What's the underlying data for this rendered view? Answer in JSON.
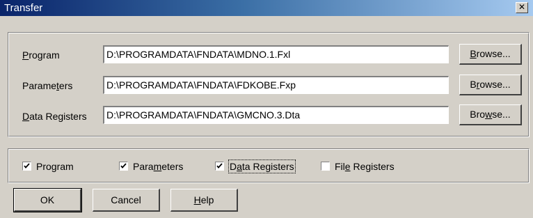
{
  "window": {
    "title": "Transfer",
    "close_icon": "close-icon"
  },
  "files": {
    "program": {
      "label_pre": "",
      "label_u": "P",
      "label_post": "rogram",
      "path": "D:\\PROGRAMDATA\\FNDATA\\MDNO.1.Fxl"
    },
    "parameters": {
      "label_pre": "Parame",
      "label_u": "t",
      "label_post": "ers",
      "path": "D:\\PROGRAMDATA\\FNDATA\\FDKOBE.Fxp"
    },
    "data_registers": {
      "label_pre": "",
      "label_u": "D",
      "label_post": "ata Registers",
      "path": "D:\\PROGRAMDATA\\FNDATA\\GMCNO.3.Dta"
    },
    "browse_buttons": [
      {
        "pre": "",
        "u": "B",
        "post": "rowse..."
      },
      {
        "pre": "B",
        "u": "r",
        "post": "owse..."
      },
      {
        "pre": "Bro",
        "u": "w",
        "post": "se..."
      }
    ]
  },
  "options": [
    {
      "pre": "Program",
      "u": "",
      "post": "",
      "checked": true
    },
    {
      "pre": "Para",
      "u": "m",
      "post": "eters",
      "checked": true
    },
    {
      "pre": "D",
      "u": "a",
      "post": "ta Registers",
      "checked": true
    },
    {
      "pre": "Fil",
      "u": "e",
      "post": " Registers",
      "checked": false
    }
  ],
  "buttons": {
    "ok": "OK",
    "cancel": "Cancel",
    "help": {
      "pre": "",
      "u": "H",
      "post": "elp"
    }
  }
}
